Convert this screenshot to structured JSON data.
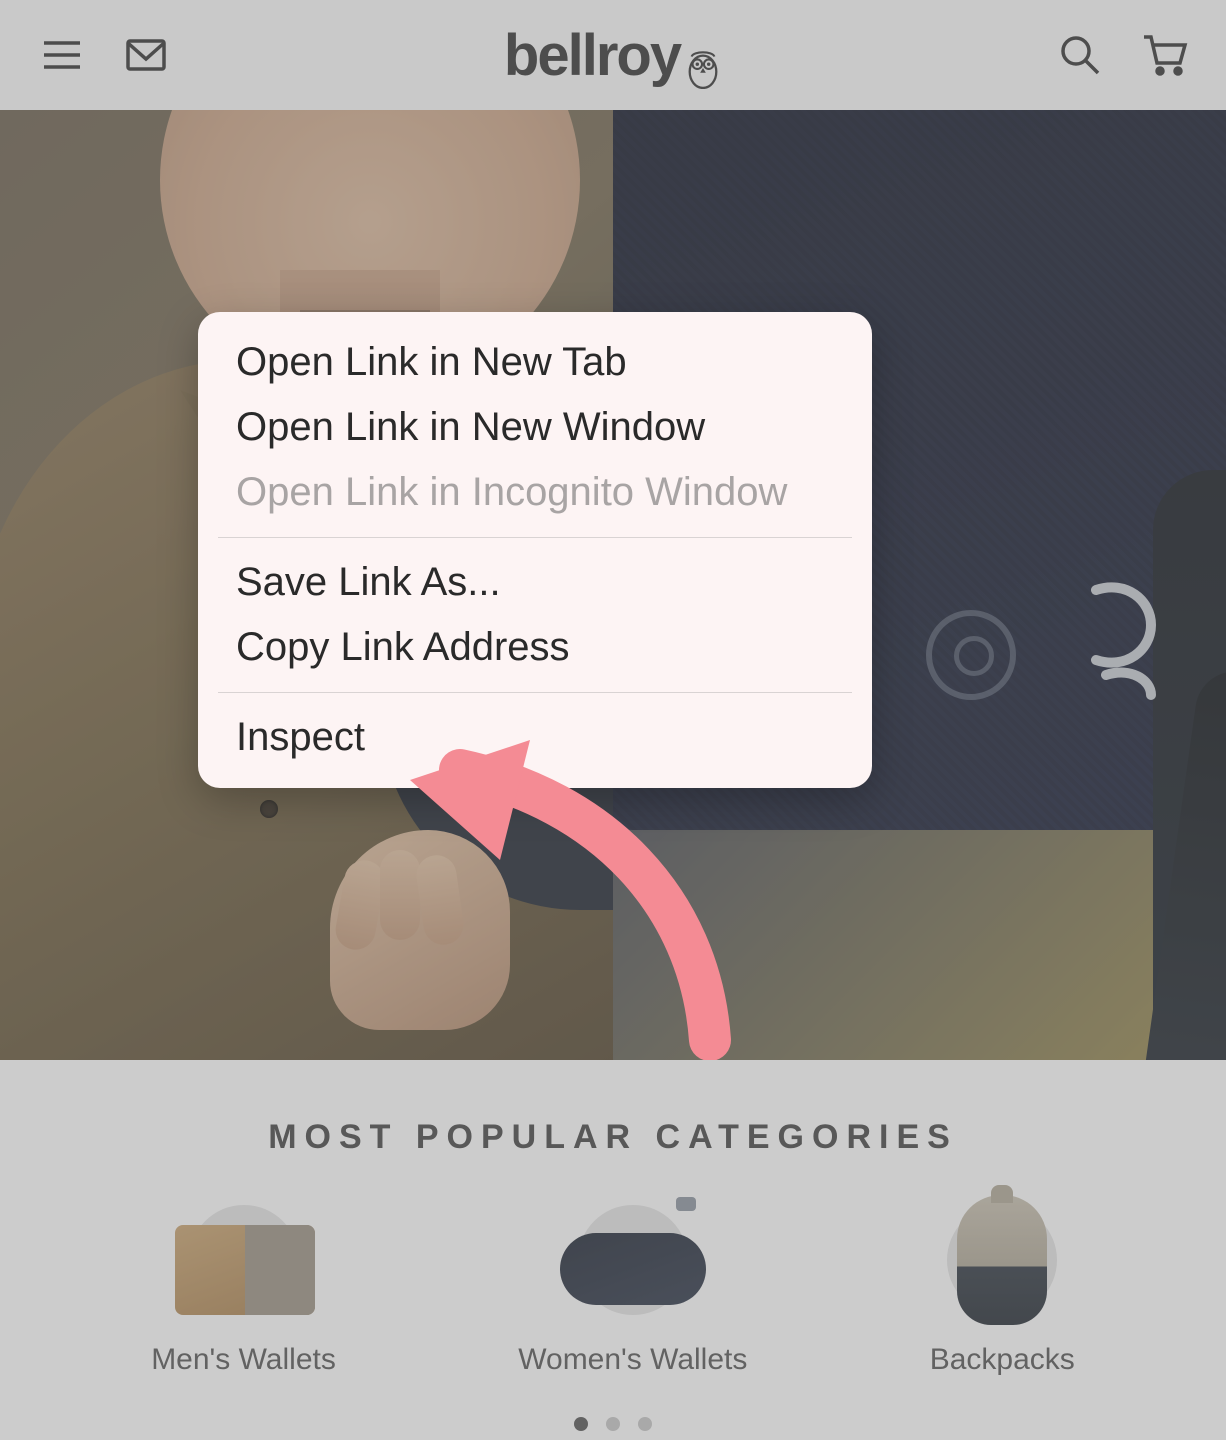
{
  "header": {
    "brand": "bellroy"
  },
  "section_title": "MOST POPULAR CATEGORIES",
  "categories": [
    {
      "label": "Men's Wallets"
    },
    {
      "label": "Women's Wallets"
    },
    {
      "label": "Backpacks"
    }
  ],
  "pagination": {
    "dots": 3,
    "active": 0
  },
  "context_menu": {
    "groups": [
      [
        {
          "label": "Open Link in New Tab",
          "enabled": true
        },
        {
          "label": "Open Link in New Window",
          "enabled": true
        },
        {
          "label": "Open Link in Incognito Window",
          "enabled": false
        }
      ],
      [
        {
          "label": "Save Link As...",
          "enabled": true
        },
        {
          "label": "Copy Link Address",
          "enabled": true
        }
      ],
      [
        {
          "label": "Inspect",
          "enabled": true
        }
      ]
    ]
  }
}
